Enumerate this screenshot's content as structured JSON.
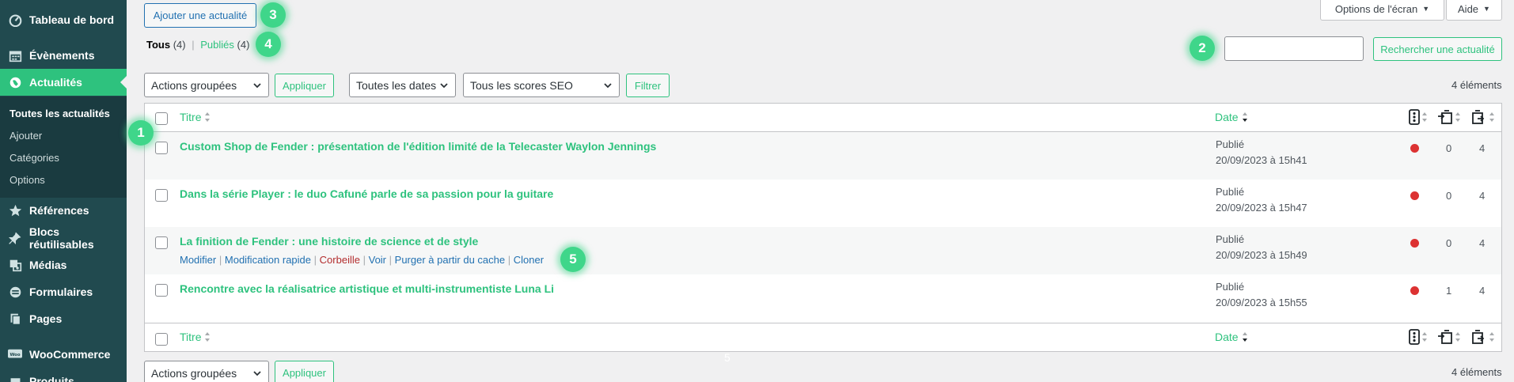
{
  "sidebar": {
    "items": [
      {
        "label": "Tableau de bord",
        "icon": "dashboard-icon"
      },
      {
        "label": "Évènements",
        "icon": "calendar-icon"
      },
      {
        "label": "Actualités",
        "icon": "globe-icon"
      },
      {
        "label": "Références",
        "icon": "star-icon"
      },
      {
        "label": "Blocs réutilisables",
        "icon": "pin-icon"
      },
      {
        "label": "Médias",
        "icon": "media-icon"
      },
      {
        "label": "Formulaires",
        "icon": "forms-icon"
      },
      {
        "label": "Pages",
        "icon": "pages-icon"
      },
      {
        "label": "WooCommerce",
        "icon": "woocommerce-icon"
      },
      {
        "label": "Produits",
        "icon": "products-icon"
      }
    ],
    "submenu": [
      "Toutes les actualités",
      "Ajouter",
      "Catégories",
      "Options"
    ]
  },
  "header": {
    "add_button": "Ajouter une actualité",
    "screen_options": "Options de l'écran",
    "help": "Aide"
  },
  "views": {
    "all_label": "Tous",
    "all_count": "(4)",
    "separator": "|",
    "published_label": "Publiés",
    "published_count": "(4)"
  },
  "search": {
    "value": "",
    "button": "Rechercher une actualité"
  },
  "filters": {
    "bulk_actions": "Actions groupées",
    "apply": "Appliquer",
    "dates": "Toutes les dates",
    "seo": "Tous les scores SEO",
    "filter": "Filtrer",
    "count": "4 éléments"
  },
  "table": {
    "col_title": "Titre",
    "col_date": "Date",
    "rows": [
      {
        "title": "Custom Shop de Fender : présentation de l'édition limité de la Telecaster Waylon Jennings",
        "status": "Publié",
        "date": "20/09/2023 à 15h41",
        "seo_status": "#dc3232",
        "links_in": "0",
        "links_out": "4"
      },
      {
        "title": "Dans la série Player : le duo Cafuné parle de sa passion pour la guitare",
        "status": "Publié",
        "date": "20/09/2023 à 15h47",
        "seo_status": "#dc3232",
        "links_in": "0",
        "links_out": "4"
      },
      {
        "title": "La finition de Fender : une histoire de science et de style",
        "status": "Publié",
        "date": "20/09/2023 à 15h49",
        "seo_status": "#dc3232",
        "links_in": "0",
        "links_out": "4"
      },
      {
        "title": "Rencontre avec la réalisatrice artistique et multi-instrumentiste Luna Li",
        "status": "Publié",
        "date": "20/09/2023 à 15h55",
        "seo_status": "#dc3232",
        "links_in": "1",
        "links_out": "4"
      }
    ],
    "row_actions": {
      "edit": "Modifier",
      "quick_edit": "Modification rapide",
      "trash": "Corbeille",
      "view": "Voir",
      "purge": "Purger à partir du cache",
      "clone": "Cloner",
      "sep": "|"
    }
  },
  "annotations": [
    "1",
    "2",
    "3",
    "4",
    "5"
  ],
  "stray_digit": "5",
  "colors": {
    "sidebar": "#214a4f",
    "accent": "#2ec27e",
    "link_blue": "#2271b1",
    "error_red": "#dc3232",
    "badge": "#3fd68a"
  }
}
